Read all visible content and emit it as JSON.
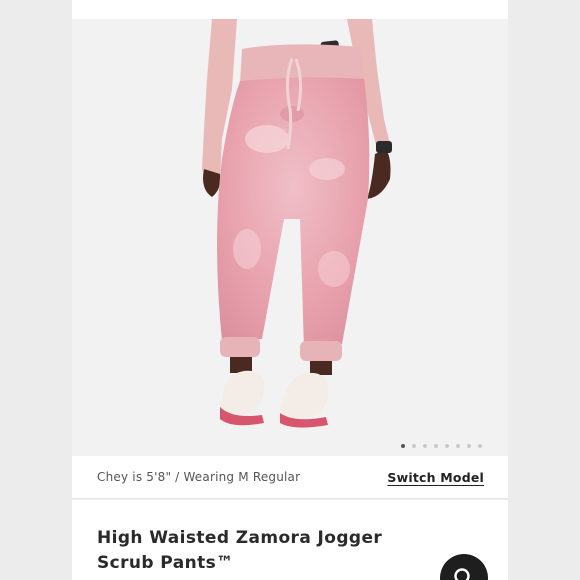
{
  "gallery": {
    "image_alt": "Model wearing pink tie-dye high waisted jogger scrub pants",
    "slide_count": 8,
    "active_slide": 1
  },
  "model_info": {
    "caption": "Chey is 5'8\" / Wearing M Regular",
    "switch_label": "Switch Model"
  },
  "product": {
    "title": "High Waisted Zamora Jogger Scrub Pants™"
  },
  "colors": {
    "pant_pink": "#eaa9b3",
    "accent_dark": "#1e1e1e",
    "background": "#ececec"
  },
  "icons": {
    "search": "search-icon"
  }
}
